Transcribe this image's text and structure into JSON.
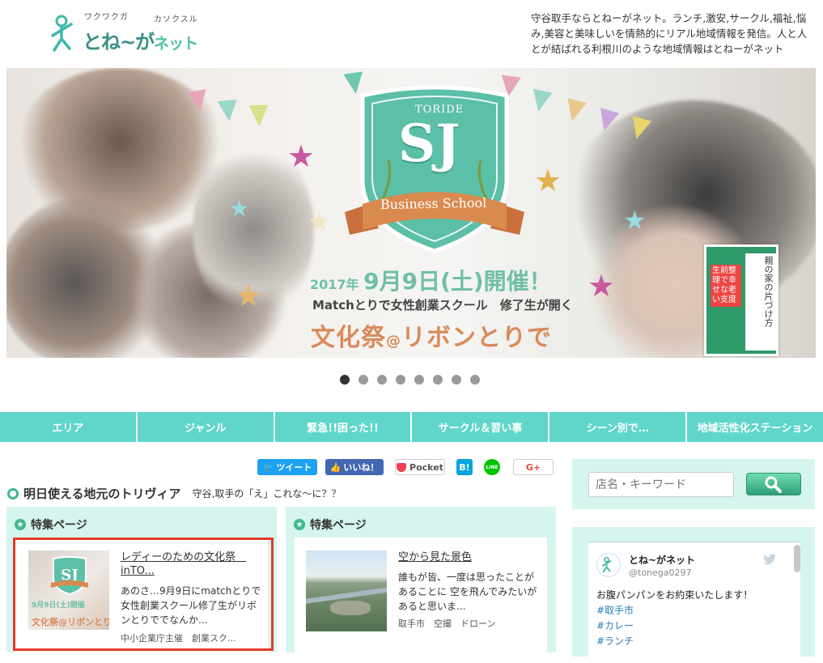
{
  "header": {
    "logo_ruby_left": "ワクワクガ",
    "logo_ruby_right": "カソクスル",
    "logo_text_a": "とね~が",
    "logo_text_b": "ネット",
    "tagline": "守谷取手ならとねーがネット。ランチ,激安,サークル,福祉,悩み,美容と美味しいを情熱的にリアル地域情報を発信。人と人とが結ばれる利根川のような地域情報はとねーがネット"
  },
  "hero": {
    "shield_top": "TORIDE",
    "shield_letters": "SJ",
    "ribbon": "Business School",
    "date_year": "2017年",
    "date_main": "9月9日(土)開催！",
    "subtitle": "Matchとりで女性創業スクール　修了生が開く",
    "main_a": "文化祭",
    "main_at": "@",
    "main_b": "リボンとりで",
    "book_title": "親の家の片づけ方",
    "book_sub": "生前整理で幸せな老い支度"
  },
  "carousel": {
    "count": 8,
    "active": 0
  },
  "nav": {
    "items": [
      "エリア",
      "ジャンル",
      "緊急!!困った!!",
      "サークル＆習い事",
      "シーン別で…",
      "地域活性化ステーション"
    ]
  },
  "share": {
    "tweet": "ツイート",
    "like": "いいね！",
    "pocket": "Pocket",
    "hatena": "B!",
    "line": "LINE",
    "gplus": "G+"
  },
  "section": {
    "title": "明日使える地元のトリヴィア",
    "subtitle": "守谷,取手の「え」これな〜に？？"
  },
  "features": [
    {
      "head": "特集ページ",
      "title": "レディーのための文化祭　inTO...",
      "desc": "あのさ…9月9日にmatchとりで女性創業スクール修了生がリボンとりででなんか...",
      "tags": "中小企業庁主催　創業スク..."
    },
    {
      "head": "特集ページ",
      "title": "空から見た景色",
      "desc": "誰もが皆、一度は思ったことがあることに 空を飛んでみたいがあると思いま...",
      "tags": "取手市　空撮　ドローン"
    }
  ],
  "search": {
    "placeholder": "店名・キーワード"
  },
  "twitter": {
    "name": "とね~がネット",
    "handle": "@tonega0297",
    "text": "お腹パンパンをお約束いたします！",
    "tags": [
      "#取手市",
      "#カレー",
      "#ランチ"
    ]
  },
  "colors": {
    "accent": "#5fd6c9",
    "panel": "#d6f5ee",
    "green": "#3fb98f",
    "highlight": "#e43a2a"
  }
}
